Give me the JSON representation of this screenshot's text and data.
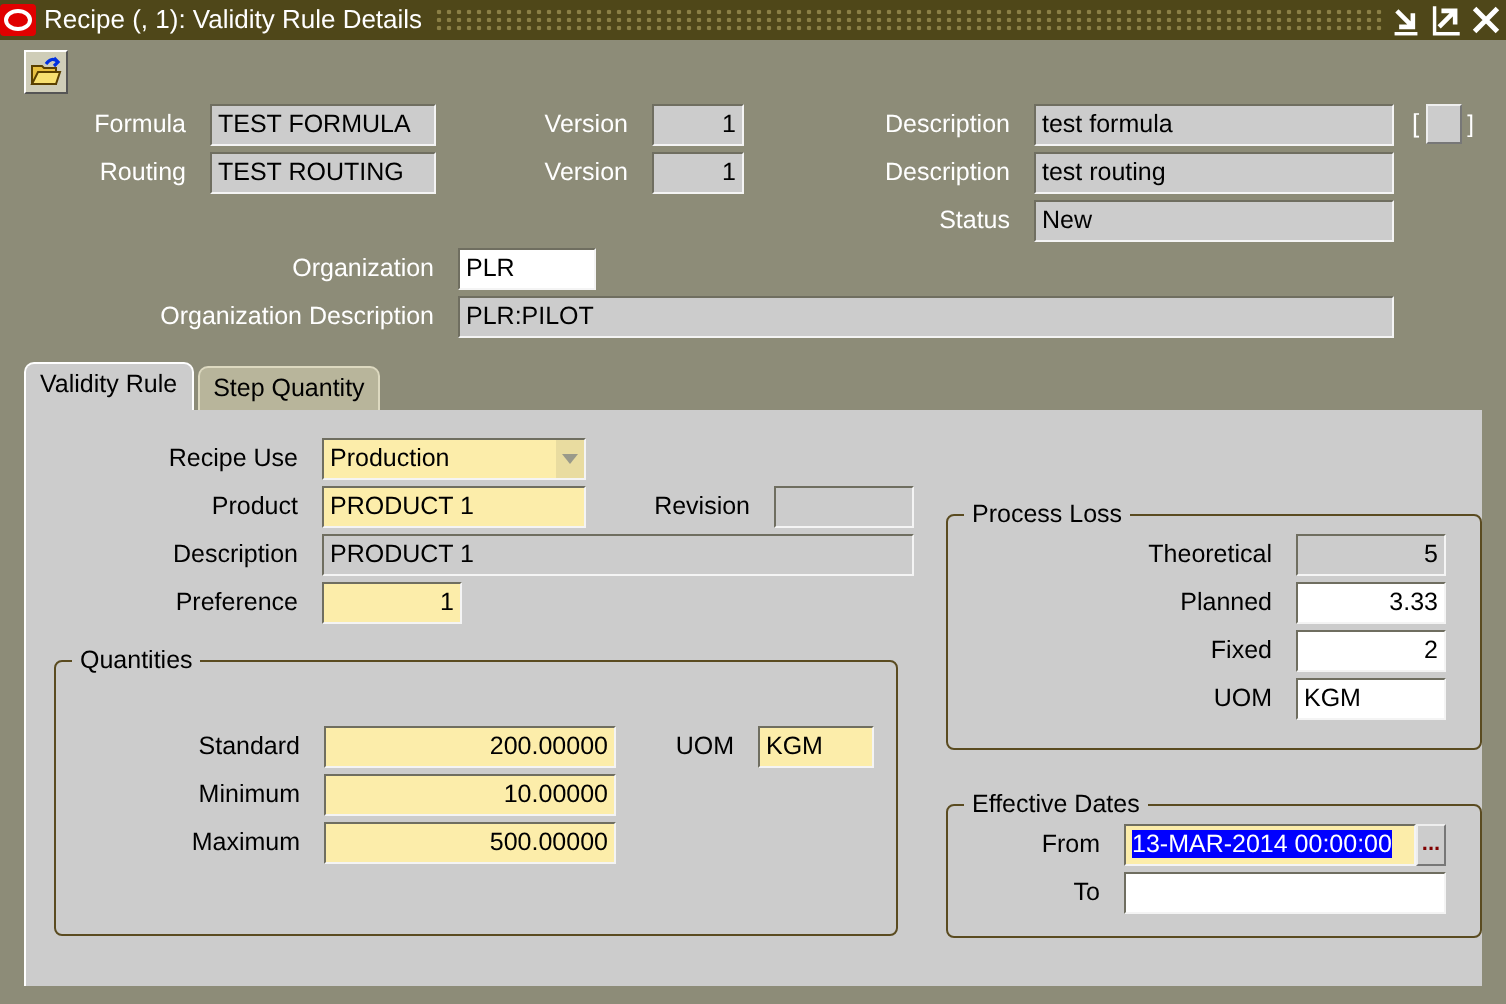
{
  "window": {
    "title": "Recipe (, 1): Validity Rule Details"
  },
  "header": {
    "formula": {
      "label": "Formula",
      "value": "TEST FORMULA",
      "kind": "readonly"
    },
    "formula_version": {
      "label": "Version",
      "value": "1",
      "kind": "readonly"
    },
    "formula_description": {
      "label": "Description",
      "value": "test formula",
      "kind": "readonly"
    },
    "flex_field": {
      "open": "[",
      "close": "]"
    },
    "routing": {
      "label": "Routing",
      "value": "TEST ROUTING",
      "kind": "readonly"
    },
    "routing_version": {
      "label": "Version",
      "value": "1",
      "kind": "readonly"
    },
    "routing_description": {
      "label": "Description",
      "value": "test routing",
      "kind": "readonly"
    },
    "status": {
      "label": "Status",
      "value": "New",
      "kind": "readonly"
    },
    "organization": {
      "label": "Organization",
      "value": "PLR",
      "kind": "optional"
    },
    "organization_description": {
      "label": "Organization Description",
      "value": "PLR:PILOT",
      "kind": "readonly"
    }
  },
  "tabs": [
    {
      "label": "Validity Rule",
      "selected": true
    },
    {
      "label": "Step Quantity",
      "selected": false
    }
  ],
  "validity_rule": {
    "recipe_use": {
      "label": "Recipe Use",
      "value": "Production",
      "kind": "required"
    },
    "product": {
      "label": "Product",
      "value": "PRODUCT 1",
      "kind": "required"
    },
    "revision": {
      "label": "Revision",
      "kind": "readonly"
    },
    "description": {
      "label": "Description",
      "value": "PRODUCT 1",
      "kind": "readonly"
    },
    "preference": {
      "label": "Preference",
      "value": "1",
      "kind": "required"
    },
    "quantities": {
      "title": "Quantities",
      "standard": {
        "label": "Standard",
        "value": "200.00000",
        "kind": "required"
      },
      "minimum": {
        "label": "Minimum",
        "value": "10.00000",
        "kind": "required"
      },
      "maximum": {
        "label": "Maximum",
        "value": "500.00000",
        "kind": "required"
      },
      "uom": {
        "label": "UOM",
        "value": "KGM",
        "kind": "required"
      }
    },
    "process_loss": {
      "title": "Process Loss",
      "theoretical": {
        "label": "Theoretical",
        "value": "5",
        "kind": "readonly"
      },
      "planned": {
        "label": "Planned",
        "value": "3.33",
        "kind": "optional"
      },
      "fixed": {
        "label": "Fixed",
        "value": "2",
        "kind": "optional"
      },
      "uom": {
        "label": "UOM",
        "value": "KGM",
        "kind": "optional"
      }
    },
    "effective_dates": {
      "title": "Effective Dates",
      "from": {
        "label": "From",
        "value": "13-MAR-2014 00:00:00",
        "kind": "required",
        "highlighted": true,
        "button": "..."
      },
      "to": {
        "label": "To",
        "kind": "optional"
      }
    }
  }
}
